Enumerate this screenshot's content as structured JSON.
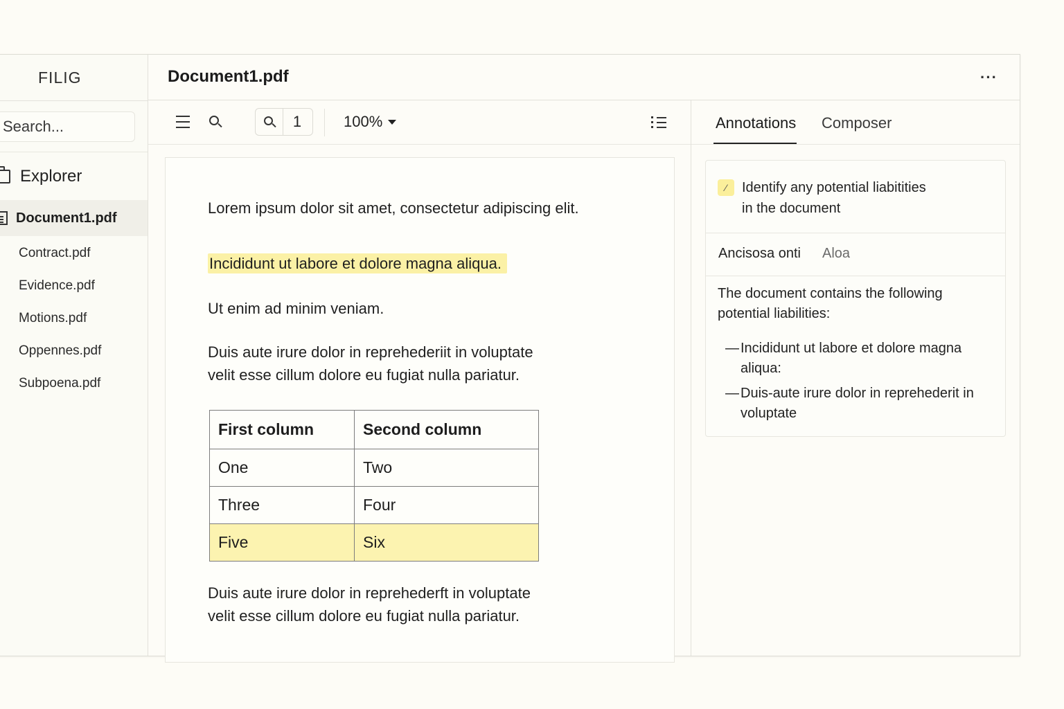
{
  "app": {
    "brand": "FILIG"
  },
  "sidebar": {
    "search_placeholder": "Search...",
    "explorer_label": "Explorer",
    "active_file": "Document1.pdf",
    "files": [
      "Contract.pdf",
      "Evidence.pdf",
      "Motions.pdf",
      "Oppennes.pdf",
      "Subpoena.pdf"
    ]
  },
  "header": {
    "title": "Document1.pdf",
    "more": "···"
  },
  "toolbar": {
    "page_number": "1",
    "zoom": "100%"
  },
  "document": {
    "p1": "Lorem ipsum dolor sit amet, consectetur  adipiscing elit.",
    "p2_highlighted": "Incididunt ut labore et dolore magna aliqua.",
    "p3": "Ut enim ad minim veniam.",
    "p4_line1": "Duis aute irure dolor in reprehederiit in voluptate",
    "p4_line2": "velit esse cillum  dolore eu fugiat nulla pariatur.",
    "table": {
      "headers": [
        "First column",
        "Second column"
      ],
      "rows": [
        [
          "One",
          "Two"
        ],
        [
          "Three",
          "Four"
        ],
        [
          "Five",
          "Six"
        ]
      ],
      "highlighted_row": 2
    },
    "p5_line1": "Duis aute irure dolor in reprehederft in voluptate",
    "p5_line2": "velit esse cillum  dolore eu fugiat nulla pariatur."
  },
  "panel": {
    "tabs": [
      "Annotations",
      "Composer"
    ],
    "active_tab": "Annotations",
    "prompt_icon": "⁄",
    "prompt_line1": "Identify any potential liabitities",
    "prompt_line2": "in the document",
    "meta_left": "Ancisosa onti",
    "meta_right": "Aloa",
    "response_line1": "The document contains the following",
    "response_line2": "potential liabilities:",
    "bullets": [
      "Incididunt ut labore et dolore magna aliqua:",
      "Duis-aute irure dolor in reprehederit in voluptate"
    ]
  },
  "colors": {
    "highlight": "#fbf1a6",
    "background": "#fdfcf6",
    "accent": "#222222"
  }
}
